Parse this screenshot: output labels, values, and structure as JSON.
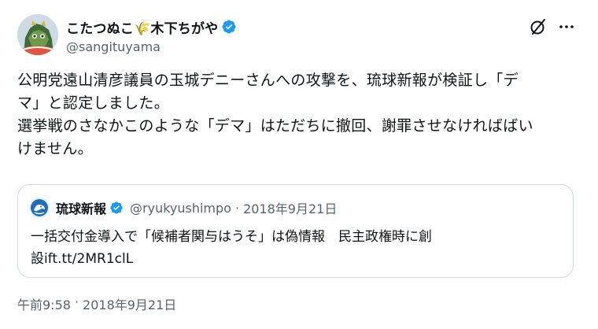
{
  "post": {
    "author": {
      "display_name": "こたつぬこ🌾木下ちがや",
      "handle": "@sangituyama",
      "verified": true,
      "avatar": "cartoon-creature-avatar"
    },
    "actions": {
      "grok_icon": "grok-icon",
      "more_icon": "more-icon"
    },
    "text_lines": [
      "公明党遠山清彦議員の玉城デニーさんへの攻撃を、琉球新報が検証し「デ",
      "マ」と認定しました。",
      "選挙戦のさなかこのような「デマ」はただちに撤回、謝罪させなければばい",
      "けません。"
    ],
    "quote": {
      "author": {
        "display_name": "琉球新報",
        "handle": "@ryukyushimpo",
        "verified": true,
        "avatar": "ryukyu-shimpo-logo"
      },
      "separator": "·",
      "date": "2018年9月21日",
      "text_lines": [
        "一括交付金導入で「候補者関与はうそ」は偽情報　民主政権時に創",
        "設ift.tt/2MR1clL"
      ]
    },
    "timestamp": {
      "time": "午前9:58",
      "separator": "·",
      "date": "2018年9月21日"
    }
  },
  "colors": {
    "text_primary": "#0f1419",
    "text_secondary": "#536471",
    "verified_blue": "#1d9bf0",
    "border": "#cfd9de"
  }
}
